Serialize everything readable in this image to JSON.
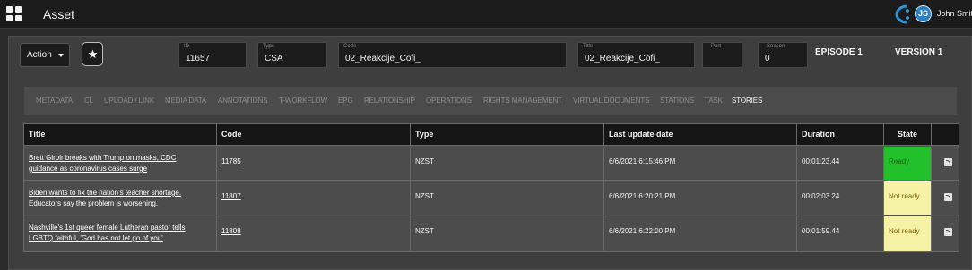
{
  "header": {
    "title": "Asset",
    "user_name": "John Smith",
    "avatar_initials": "JS"
  },
  "toolbar": {
    "action_label": "Action"
  },
  "fields": {
    "id": {
      "label": "ID",
      "value": "11657"
    },
    "type": {
      "label": "Type",
      "value": "CSA"
    },
    "code": {
      "label": "Code",
      "value": "02_Reakcije_Cofi_"
    },
    "title": {
      "label": "Title",
      "value": "02_Reakcije_Cofi_"
    },
    "part": {
      "label": "Part",
      "value": ""
    },
    "season": {
      "label": "Season",
      "value": "0"
    }
  },
  "episode_label": "EPISODE 1",
  "version_label": "VERSION 1",
  "tabs": [
    "METADATA",
    "CL",
    "UPLOAD / LINK",
    "MEDIA DATA",
    "ANNOTATIONS",
    "T-WORKFLOW",
    "EPG",
    "RELATIONSHIP",
    "OPERATIONS",
    "RIGHTS MANAGEMENT",
    "VIRTUAL DOCUMENTS",
    "STATIONS",
    "TASK",
    "STORIES"
  ],
  "active_tab": "STORIES",
  "table": {
    "columns": [
      "Title",
      "Code",
      "Type",
      "Last update date",
      "Duration",
      "State"
    ],
    "rows": [
      {
        "title_line1": "Brett Giroir breaks with Trump on masks, CDC",
        "title_line2": "guidance as coronavirus cases surge",
        "code": "11785",
        "type": "NZST",
        "updated": "6/6/2021 6:15:46 PM",
        "duration": "00:01:23.44",
        "state": "Ready"
      },
      {
        "title_line1": "Biden wants to fix the nation's teacher shortage.",
        "title_line2": "Educators say the problem is worsening.",
        "code": "11807",
        "type": "NZST",
        "updated": "6/6/2021 6:20:21 PM",
        "duration": "00:02:03.24",
        "state": "Not ready"
      },
      {
        "title_line1": "Nashville's 1st queer female Lutheran pastor tells",
        "title_line2": "LGBTQ faithful, 'God has not let go of you'",
        "code": "11808",
        "type": "NZST",
        "updated": "6/6/2021 6:22:00 PM",
        "duration": "00:01:59.44",
        "state": "Not ready"
      }
    ]
  },
  "colors": {
    "ready": "#22c02a",
    "not_ready": "#f5f2a6",
    "header_bg": "#1b1b1b",
    "panel_bg": "#3e3e3e"
  },
  "icons": [
    "apps-grid-icon",
    "brand-logo-icon",
    "star-icon",
    "chevron-down-icon",
    "rss-icon"
  ]
}
